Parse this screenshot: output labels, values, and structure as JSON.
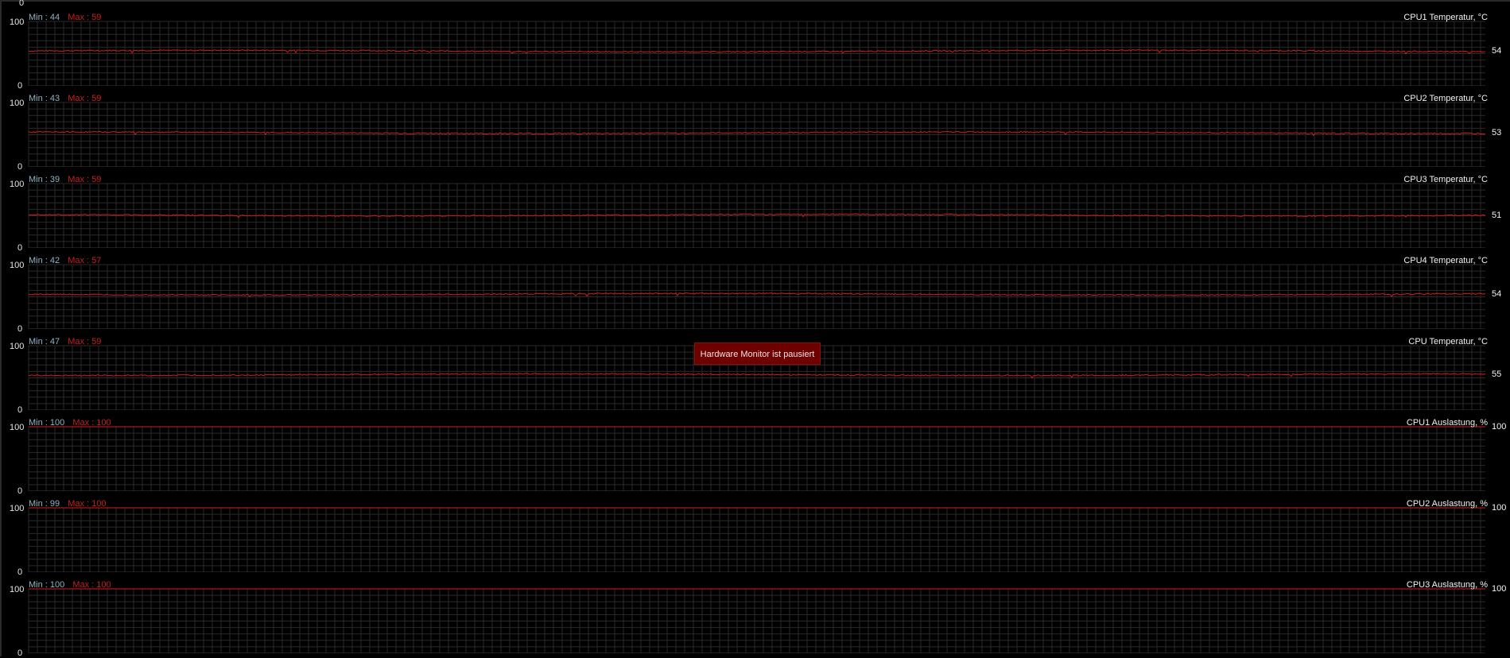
{
  "colors": {
    "background": "#000000",
    "grid": "#2a2a2a",
    "trace": "#d51b1b",
    "min_text": "#8fb3c6",
    "max_text": "#c81f1f",
    "paused_badge": "#6e0000"
  },
  "status": {
    "paused_text": "Hardware Monitor ist pausiert"
  },
  "panels": [
    {
      "title": "CPU1 Temperatur, °C",
      "min_text": "Min : 44",
      "max_text": "Max : 59",
      "current": "54",
      "y_max": "100",
      "y_min": "0",
      "level": 54,
      "noise": 3
    },
    {
      "title": "CPU2 Temperatur, °C",
      "min_text": "Min : 43",
      "max_text": "Max : 59",
      "current": "53",
      "y_max": "100",
      "y_min": "0",
      "level": 53,
      "noise": 3
    },
    {
      "title": "CPU3 Temperatur, °C",
      "min_text": "Min : 39",
      "max_text": "Max : 59",
      "current": "51",
      "y_max": "100",
      "y_min": "0",
      "level": 51,
      "noise": 3
    },
    {
      "title": "CPU4 Temperatur, °C",
      "min_text": "Min : 42",
      "max_text": "Max : 57",
      "current": "54",
      "y_max": "100",
      "y_min": "0",
      "level": 54,
      "noise": 3
    },
    {
      "title": "CPU Temperatur, °C",
      "min_text": "Min : 47",
      "max_text": "Max : 59",
      "current": "55",
      "y_max": "100",
      "y_min": "0",
      "level": 55,
      "noise": 3
    },
    {
      "title": "CPU1 Auslastung, %",
      "min_text": "Min : 100",
      "max_text": "Max : 100",
      "current": "100",
      "y_max": "100",
      "y_min": "0",
      "level": 100,
      "noise": 0
    },
    {
      "title": "CPU2 Auslastung, %",
      "min_text": "Min : 99",
      "max_text": "Max : 100",
      "current": "100",
      "y_max": "100",
      "y_min": "0",
      "level": 100,
      "noise": 0
    },
    {
      "title": "CPU3 Auslastung, %",
      "min_text": "Min : 100",
      "max_text": "Max : 100",
      "current": "100",
      "y_max": "100",
      "y_min": "0",
      "level": 100,
      "noise": 0
    }
  ]
}
